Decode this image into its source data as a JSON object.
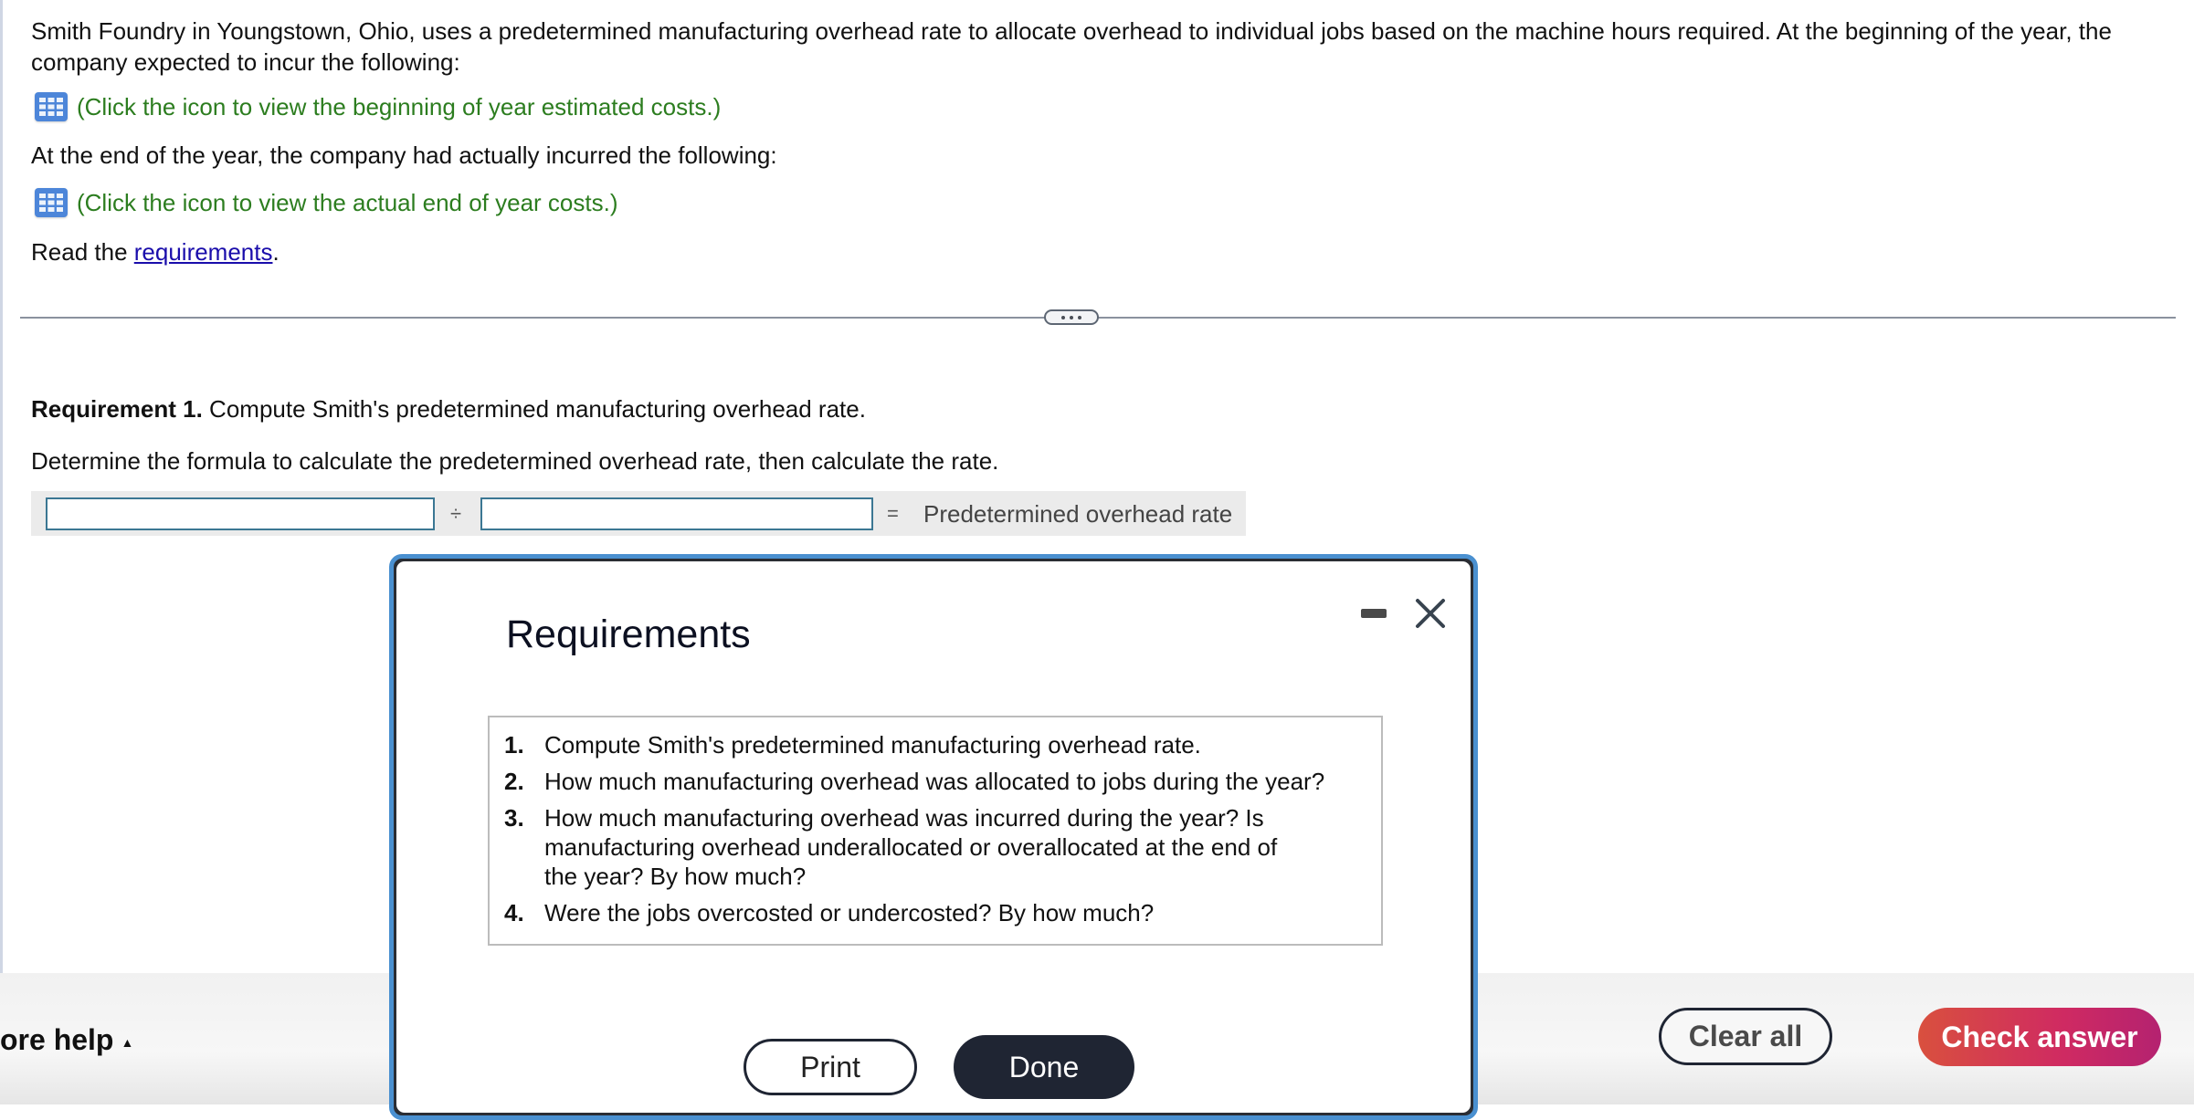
{
  "problem": {
    "intro": "Smith Foundry in Youngstown, Ohio, uses a predetermined manufacturing overhead rate to allocate overhead to individual jobs based on the machine hours required. At the beginning of the year, the company expected to incur the following:",
    "estimated_costs_link": "(Click the icon to view the beginning of year estimated costs.)",
    "end_of_year_text": "At the end of the year, the company had actually incurred the following:",
    "actual_costs_link": "(Click the icon to view the actual end of year costs.)",
    "read_prefix": "Read the ",
    "read_link": "requirements",
    "read_suffix": "."
  },
  "requirement1": {
    "label": "Requirement 1.",
    "text": " Compute Smith's predetermined manufacturing overhead rate.",
    "instruction": "Determine the formula to calculate the predetermined overhead rate, then calculate the rate.",
    "formula": {
      "input1_value": "",
      "operator": "÷",
      "input2_value": "",
      "equals": "=",
      "result_label": "Predetermined overhead rate"
    }
  },
  "modal": {
    "title": "Requirements",
    "items": [
      {
        "num": "1.",
        "text": "Compute Smith's predetermined manufacturing overhead rate."
      },
      {
        "num": "2.",
        "text": "How much manufacturing overhead was allocated to jobs during the year?"
      },
      {
        "num": "3.",
        "text": "How much manufacturing overhead was incurred during the year? Is manufacturing overhead underallocated or overallocated at the end of the year? By how much?"
      },
      {
        "num": "4.",
        "text": "Were the jobs overcosted or undercosted? By how much?"
      }
    ],
    "print_label": "Print",
    "done_label": "Done"
  },
  "footer": {
    "more_help": "ore help",
    "more_help_arrow": "▲",
    "clear_all": "Clear all",
    "check_answer": "Check answer"
  },
  "colors": {
    "link_green": "#2c7d1f",
    "input_border": "#3b7793",
    "check_answer_gradient": [
      "#d9503e",
      "#b42270"
    ],
    "modal_border": "#4a90d0"
  }
}
